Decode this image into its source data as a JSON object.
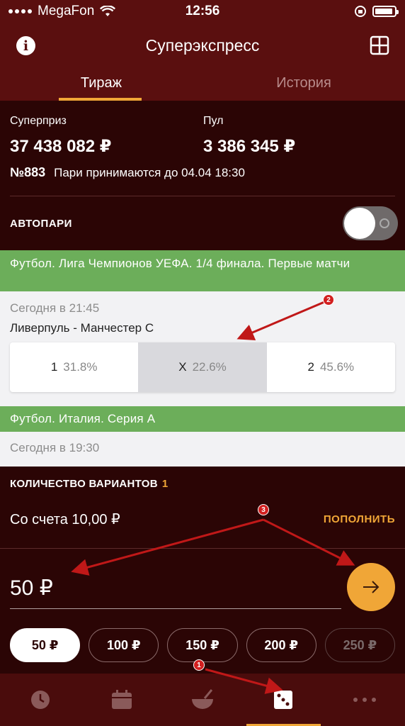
{
  "status": {
    "carrier": "MegaFon",
    "time": "12:56"
  },
  "header": {
    "title": "Суперэкспресс"
  },
  "tabs": [
    {
      "label": "Тираж",
      "active": true
    },
    {
      "label": "История",
      "active": false
    }
  ],
  "draw": {
    "superprize_label": "Суперприз",
    "superprize_value": "37 438 082 ₽",
    "pool_label": "Пул",
    "pool_value": "3 386 345 ₽",
    "number": "№883",
    "deadline": "Пари принимаются до 04.04 18:30"
  },
  "autopay": {
    "label": "АВТОПАРИ",
    "enabled": false
  },
  "leagues": [
    {
      "title": "Футбол. Лига Чемпионов УЕФА. 1/4 финала. Первые матчи",
      "match": {
        "time": "Сегодня в 21:45",
        "teams": "Ливерпуль - Манчестер С",
        "odds": [
          {
            "key": "1",
            "value": "31.8%",
            "selected": false
          },
          {
            "key": "X",
            "value": "22.6%",
            "selected": true
          },
          {
            "key": "2",
            "value": "45.6%",
            "selected": false
          }
        ]
      }
    },
    {
      "title": "Футбол. Италия. Серия А",
      "match": {
        "time": "Сегодня в 19:30"
      }
    }
  ],
  "bet": {
    "variants_label": "КОЛИЧЕСТВО ВАРИАНТОВ",
    "variants_count": "1",
    "account_text": "Со счета 10,00 ₽",
    "topup_label": "ПОПОЛНИТЬ",
    "amount": "50 ₽",
    "chips": [
      "50 ₽",
      "100 ₽",
      "150 ₽",
      "200 ₽",
      "250 ₽"
    ]
  },
  "annotations": [
    "1",
    "2",
    "3"
  ],
  "colors": {
    "accent": "#f0a637",
    "header": "#5a0f0f",
    "league": "#6cae5a",
    "background": "#2b0505"
  },
  "bottom_nav": [
    "clock-icon",
    "calendar-icon",
    "bowl-icon",
    "dice-icon",
    "more-icon"
  ]
}
